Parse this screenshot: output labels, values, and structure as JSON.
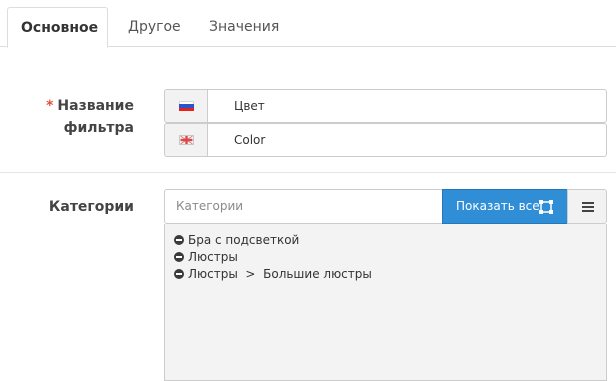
{
  "tabs": [
    {
      "label": "Основное",
      "active": true
    },
    {
      "label": "Другое",
      "active": false
    },
    {
      "label": "Значения",
      "active": false
    }
  ],
  "filter_name": {
    "required_mark": "*",
    "label_line1": "Название",
    "label_line2": "фильтра",
    "entries": [
      {
        "flag": "ru-flag-icon",
        "value": "Цвет"
      },
      {
        "flag": "gb-flag-icon",
        "value": "Color"
      }
    ]
  },
  "categories": {
    "label": "Категории",
    "placeholder": "Категории",
    "show_all_label": "Показать все",
    "items": [
      {
        "text": "Бра с подсветкой"
      },
      {
        "text": "Люстры"
      },
      {
        "text": "Люстры  >  Большие люстры"
      }
    ]
  },
  "colors": {
    "accent": "#2f8ed6",
    "required": "#e3503e"
  }
}
